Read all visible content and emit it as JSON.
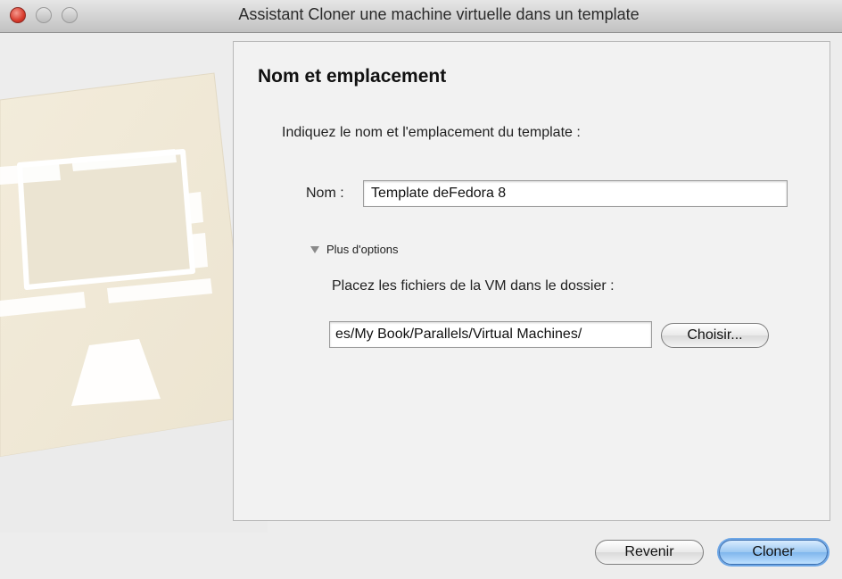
{
  "window": {
    "title": "Assistant Cloner une machine virtuelle dans un template"
  },
  "content": {
    "heading": "Nom et emplacement",
    "intro": "Indiquez le nom et l'emplacement du template :",
    "name_label": "Nom :",
    "name_value": "Template deFedora 8",
    "more_options_label": "Plus d'options",
    "folder_label": "Placez les fichiers de la VM dans le dossier :",
    "folder_path_visible": "es/My Book/Parallels/Virtual Machines/",
    "choose_button": "Choisir..."
  },
  "footer": {
    "back_button": "Revenir",
    "clone_button": "Cloner"
  },
  "icons": {
    "close": "close-icon",
    "minimize": "minimize-icon",
    "zoom": "zoom-icon",
    "disclosure": "disclosure-triangle-icon"
  },
  "colors": {
    "close_red": "#d83b2d",
    "default_button_blue": "#7fb6ec"
  }
}
